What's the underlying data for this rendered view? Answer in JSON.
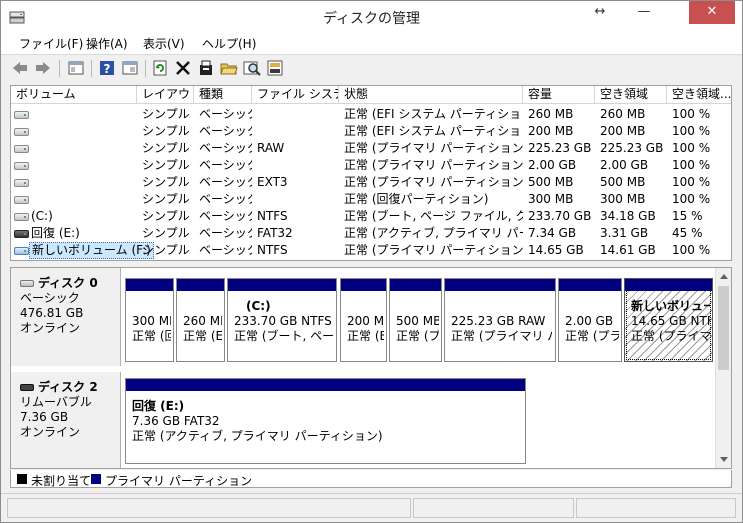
{
  "window": {
    "title": "ディスクの管理",
    "resize_glyph": "↔",
    "minimize_glyph": "—",
    "close_glyph": "✕"
  },
  "menu": [
    "ファイル(F)",
    "操作(A)",
    "表示(V)",
    "ヘルプ(H)"
  ],
  "toolbar_icons": [
    "back-arrow-icon",
    "forward-arrow-icon",
    "console-icon",
    "help-icon",
    "properties-icon",
    "refresh-icon",
    "delete-icon",
    "settings-icon",
    "open-folder-icon",
    "search-icon",
    "disk-properties-icon"
  ],
  "list": {
    "columns": [
      "ボリューム",
      "レイアウト",
      "種類",
      "ファイル システム",
      "状態",
      "容量",
      "空き領域",
      "空き領域..."
    ],
    "rows": [
      {
        "volume": "",
        "layout": "シンプル",
        "type": "ベーシック",
        "fs": "",
        "status": "正常 (EFI システム パーティション)",
        "capacity": "260 MB",
        "free": "260 MB",
        "pct": "100 %"
      },
      {
        "volume": "",
        "layout": "シンプル",
        "type": "ベーシック",
        "fs": "",
        "status": "正常 (EFI システム パーティション)",
        "capacity": "200 MB",
        "free": "200 MB",
        "pct": "100 %"
      },
      {
        "volume": "",
        "layout": "シンプル",
        "type": "ベーシック",
        "fs": "RAW",
        "status": "正常 (プライマリ パーティション)",
        "capacity": "225.23 GB",
        "free": "225.23 GB",
        "pct": "100 %"
      },
      {
        "volume": "",
        "layout": "シンプル",
        "type": "ベーシック",
        "fs": "",
        "status": "正常 (プライマリ パーティション)",
        "capacity": "2.00 GB",
        "free": "2.00 GB",
        "pct": "100 %"
      },
      {
        "volume": "",
        "layout": "シンプル",
        "type": "ベーシック",
        "fs": "EXT3",
        "status": "正常 (プライマリ パーティション)",
        "capacity": "500 MB",
        "free": "500 MB",
        "pct": "100 %"
      },
      {
        "volume": "",
        "layout": "シンプル",
        "type": "ベーシック",
        "fs": "",
        "status": "正常 (回復パーティション)",
        "capacity": "300 MB",
        "free": "300 MB",
        "pct": "100 %"
      },
      {
        "volume": "(C:)",
        "layout": "シンプル",
        "type": "ベーシック",
        "fs": "NTFS",
        "status": "正常 (ブート, ページ ファイル, ク...",
        "capacity": "233.70 GB",
        "free": "34.18 GB",
        "pct": "15 %"
      },
      {
        "volume": "回復 (E:)",
        "layout": "シンプル",
        "type": "ベーシック",
        "fs": "FAT32",
        "status": "正常 (アクティブ, プライマリ パーテ...",
        "capacity": "7.34 GB",
        "free": "3.31 GB",
        "pct": "45 %"
      },
      {
        "volume": "新しいボリューム (F:)",
        "layout": "シンプル",
        "type": "ベーシック",
        "fs": "NTFS",
        "status": "正常 (プライマリ パーティション)",
        "capacity": "14.65 GB",
        "free": "14.61 GB",
        "pct": "100 %"
      }
    ]
  },
  "disks": [
    {
      "name": "ディスク 0",
      "kind": "ベーシック",
      "size": "476.81 GB",
      "state": "オンライン",
      "partitions": [
        {
          "label": "",
          "line1": "300 MB",
          "line2": "正常 (回"
        },
        {
          "label": "",
          "line1": "260 MB",
          "line2": "正常 (E"
        },
        {
          "label": "(C:)",
          "line1": "233.70 GB NTFS",
          "line2": "正常 (ブート, ページ"
        },
        {
          "label": "",
          "line1": "200 MB",
          "line2": "正常 (E"
        },
        {
          "label": "",
          "line1": "500 MB EXT3",
          "line2": "正常 (プ"
        },
        {
          "label": "",
          "line1": "225.23 GB RAW",
          "line2": "正常 (プライマリ パー"
        },
        {
          "label": "",
          "line1": "2.00 GB",
          "line2": "正常 (プラ"
        },
        {
          "label": "新しいボリューム",
          "line1": "14.65 GB NTFS",
          "line2": "正常 (プライマリ"
        }
      ]
    },
    {
      "name": "ディスク 2",
      "kind": "リムーバブル",
      "size": "7.36 GB",
      "state": "オンライン",
      "partitions": [
        {
          "label": "回復 (E:)",
          "line1": "7.36 GB FAT32",
          "line2": "正常 (アクティブ, プライマリ パーティション)"
        }
      ]
    }
  ],
  "legend": {
    "unallocated": "未割り当て",
    "primary": "プライマリ パーティション",
    "unallocated_color": "#000000",
    "primary_color": "#000080"
  }
}
